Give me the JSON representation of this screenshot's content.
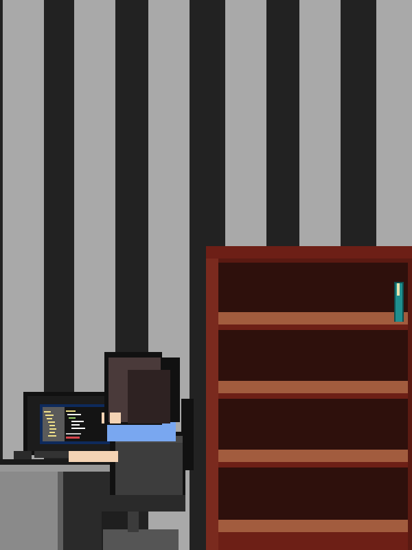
{
  "scene": {
    "kind": "pixel-art room",
    "palette": {
      "wall_light": "#a9a9a9",
      "wall_stripe": "#222222",
      "desk_top": "#8f8f8f",
      "desk_side": "#7a7a7a",
      "shelf_frame": "#6d1f16",
      "shelf_back": "#2e100c",
      "shelf_board": "#a25c3e",
      "monitor_frame": "#111111",
      "monitor_screen": "#0e2a5c",
      "hair": "#3a2a2a",
      "shirt": "#79a7f0",
      "skin": "#f4d3b4",
      "chair": "#404040",
      "book": "#1f8f8f"
    },
    "objects": {
      "wall": {
        "icon": "striped-wallpaper"
      },
      "desk": {
        "icon": "desk"
      },
      "monitor": {
        "icon": "monitor-with-code"
      },
      "person": {
        "icon": "person-from-behind"
      },
      "chair": {
        "icon": "office-chair"
      },
      "bookshelf": {
        "icon": "bookshelf",
        "shelf_count": 4,
        "books": 1
      }
    }
  }
}
